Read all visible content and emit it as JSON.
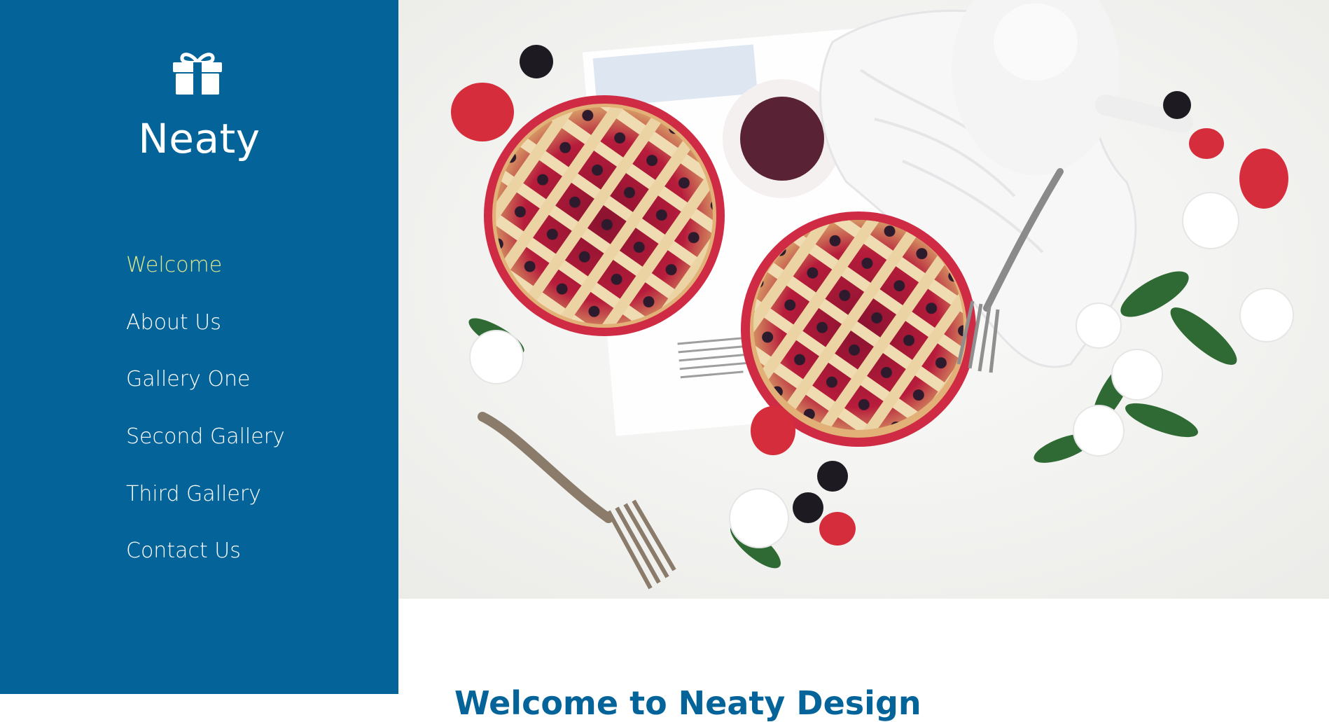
{
  "sidebar": {
    "brand": "Neaty",
    "logo_icon": "gift-icon",
    "background": "#046399",
    "nav": [
      {
        "label": "Welcome",
        "active": true
      },
      {
        "label": "About Us",
        "active": false
      },
      {
        "label": "Gallery One",
        "active": false
      },
      {
        "label": "Second Gallery",
        "active": false
      },
      {
        "label": "Third Gallery",
        "active": false
      },
      {
        "label": "Contact Us",
        "active": false
      }
    ],
    "active_color": "#dbe88c"
  },
  "main": {
    "hero_image": "berry-pies-table-photo",
    "heading": "Welcome to Neaty Design"
  }
}
